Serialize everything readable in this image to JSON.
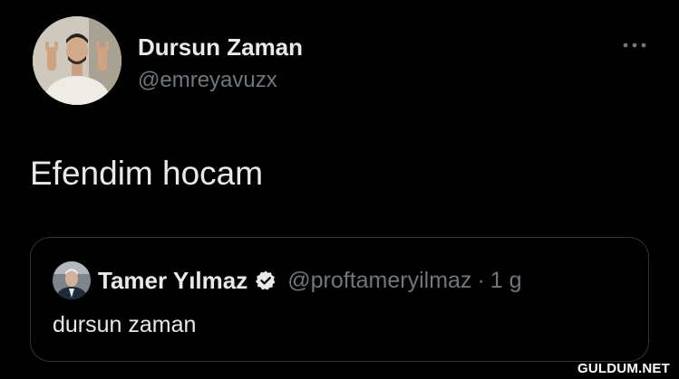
{
  "tweet": {
    "author": {
      "display_name": "Dursun Zaman",
      "handle": "@emreyavuzx",
      "avatar_icon": "user-photo-avatar"
    },
    "more_icon": "more-dots-icon",
    "text": "Efendim hocam",
    "quoted": {
      "author": {
        "display_name": "Tamer Yılmaz",
        "handle": "@proftameryilmaz",
        "verified": true,
        "verified_icon": "verified-badge-icon",
        "avatar_icon": "user-photo-avatar"
      },
      "separator": "·",
      "time": "1 g",
      "text": "dursun zaman"
    }
  },
  "watermark": "GULDUM.NET",
  "colors": {
    "background": "#000000",
    "primary_text": "#e7e9ea",
    "secondary_text": "#71767b",
    "border": "#333639"
  }
}
